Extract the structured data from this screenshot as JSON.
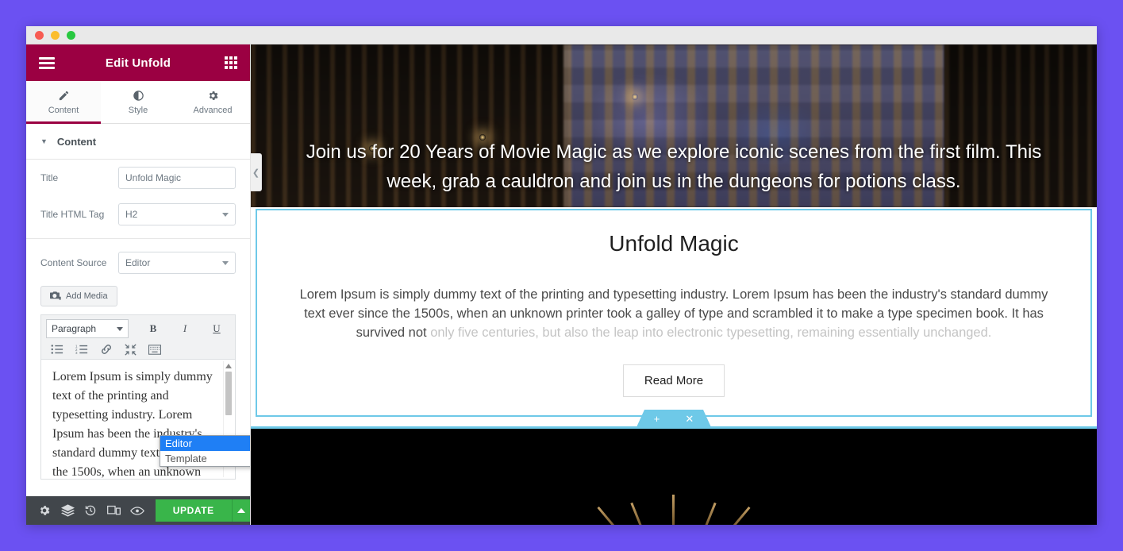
{
  "window": {
    "traffic_lights": [
      "red",
      "yellow",
      "green"
    ]
  },
  "panel": {
    "header": {
      "title": "Edit Unfold",
      "menu_icon": "hamburger-icon",
      "grid_icon": "widgets-grid-icon"
    },
    "tabs": [
      {
        "label": "Content",
        "icon": "pencil-icon",
        "active": true
      },
      {
        "label": "Style",
        "icon": "contrast-icon",
        "active": false
      },
      {
        "label": "Advanced",
        "icon": "gear-icon",
        "active": false
      }
    ],
    "section": {
      "label": "Content",
      "caret": "caret-down-icon"
    },
    "fields": {
      "title": {
        "label": "Title",
        "value": "Unfold Magic",
        "placeholder": ""
      },
      "title_html_tag": {
        "label": "Title HTML Tag",
        "value": "H2"
      },
      "content_source": {
        "label": "Content Source",
        "value": "Editor",
        "options": [
          "Editor",
          "Template"
        ],
        "selected": "Editor",
        "open": true
      }
    },
    "add_media_label": "Add Media",
    "editor": {
      "format_select": "Paragraph",
      "bold": "B",
      "italic": "I",
      "underline": "U",
      "toolbar_icons": [
        "bullet-list-icon",
        "numbered-list-icon",
        "link-icon",
        "fullscreen-icon",
        "toolbar-toggle-icon"
      ],
      "body_text": "Lorem Ipsum is simply dummy text of the printing and typesetting industry. Lorem Ipsum has been the industry's standard dummy text ever since the 1500s, when an unknown printer took a galley of type and scrambled it to make a type specimen book."
    },
    "footer": {
      "icons": [
        "settings-gear-icon",
        "navigator-layers-icon",
        "history-revisions-icon",
        "responsive-mode-icon",
        "preview-eye-icon"
      ],
      "update_label": "UPDATE",
      "update_caret": "caret-up-icon",
      "update_color": "#39b54a"
    }
  },
  "preview": {
    "collapse_handle_icon": "chevron-left-icon",
    "hero_text": "Join us for 20 Years of Movie Magic as we explore iconic scenes from the first film. This week, grab a cauldron and join us in the dungeons for potions class.",
    "widget": {
      "heading": "Unfold Magic",
      "paragraph_visible": "Lorem Ipsum is simply dummy text of the printing and typesetting industry. Lorem Ipsum has been the industry's standard dummy text ever since the 1500s, when an unknown printer took a galley of type and scrambled it to make a type specimen book. It has survived not",
      "paragraph_faded": "only five centuries, but also the leap into electronic typesetting, remaining essentially unchanged.",
      "read_more_label": "Read More",
      "selection_color": "#6ec9e8",
      "actions": [
        "add-section-icon",
        "drag-handle-icon",
        "remove-icon"
      ]
    }
  },
  "colors": {
    "desktop_background": "#6b51f2",
    "panel_header": "#9b0042",
    "accent_selection": "#6ec9e8",
    "update_green": "#39b54a",
    "dropdown_highlight": "#1f7ff5"
  }
}
